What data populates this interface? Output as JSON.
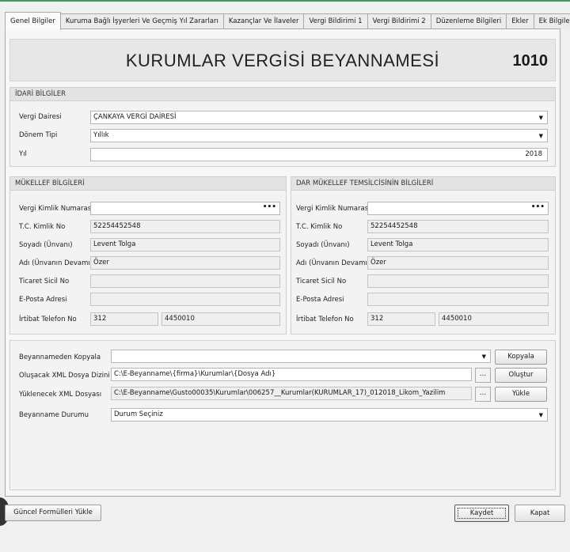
{
  "tabs": [
    "Genel Bilgiler",
    "Kuruma Bağlı İşyerleri Ve Geçmiş Yıl Zararları",
    "Kazançlar Ve İlaveler",
    "Vergi Bildirimi 1",
    "Vergi Bildirimi 2",
    "Düzenleme Bilgileri",
    "Ekler",
    "Ek Bilgiler"
  ],
  "header": {
    "title": "KURUMLAR VERGİSİ BEYANNAMESİ",
    "code": "1010"
  },
  "idari": {
    "heading": "İDARİ BİLGİLER",
    "vergi_dairesi_label": "Vergi Dairesi",
    "vergi_dairesi_value": "ÇANKAYA VERGİ DAİRESİ",
    "donem_tipi_label": "Dönem Tipi",
    "donem_tipi_value": "Yıllık",
    "yil_label": "Yıl",
    "yil_value": "2018"
  },
  "mukellef": {
    "heading": "MÜKELLEF BİLGİLERİ",
    "vkn_label": "Vergi Kimlik Numarası",
    "vkn_value": "",
    "tc_label": "T.C. Kimlik No",
    "tc_value": "52254452548",
    "soyadi_label": "Soyadı (Ünvanı)",
    "soyadi_value": "Levent Tolga",
    "adi_label": "Adı (Ünvanın Devamı)",
    "adi_value": "Özer",
    "ticaret_label": "Ticaret Sicil No",
    "ticaret_value": "",
    "eposta_label": "E-Posta Adresi",
    "eposta_value": "",
    "tel_label": "İrtibat Telefon No",
    "tel_area": "312",
    "tel_number": "4450010"
  },
  "temsilci": {
    "heading": "DAR MÜKELLEF TEMSİLCİSİNİN BİLGİLERİ",
    "vkn_label": "Vergi Kimlik Numarası",
    "vkn_value": "",
    "tc_label": "T.C. Kimlik No",
    "tc_value": "52254452548",
    "soyadi_label": "Soyadı (Ünvanı)",
    "soyadi_value": "Levent Tolga",
    "adi_label": "Adı (Ünvanın Devamı)",
    "adi_value": "Özer",
    "ticaret_label": "Ticaret Sicil No",
    "ticaret_value": "",
    "eposta_label": "E-Posta Adresi",
    "eposta_value": "",
    "tel_label": "İrtibat Telefon No",
    "tel_area": "312",
    "tel_number": "4450010"
  },
  "files": {
    "kopyala_label": "Beyannameden Kopyala",
    "kopyala_value": "",
    "kopyala_button": "Kopyala",
    "olustur_label": "Oluşacak XML Dosya Dizini",
    "olustur_value": "C:\\E-Beyanname\\{firma}\\Kurumlar\\{Dosya Adı}",
    "olustur_button": "Oluştur",
    "yukle_label": "Yüklenecek XML Dosyası",
    "yukle_value": "C:\\E-Beyanname\\Gusto00035\\Kurumlar\\006257__Kurumlar(KURUMLAR_17)_012018_Likom_Yazilim",
    "yukle_button": "Yükle",
    "durum_label": "Beyanname Durumu",
    "durum_value": "Durum Seçiniz",
    "ellipsis": "..."
  },
  "footer": {
    "guncel_button": "Güncel Formülleri Yükle",
    "kaydet_button": "Kaydet",
    "kapat_button": "Kapat"
  },
  "glyphs": {
    "dropdown": "▼",
    "ellipsis": "•••"
  }
}
